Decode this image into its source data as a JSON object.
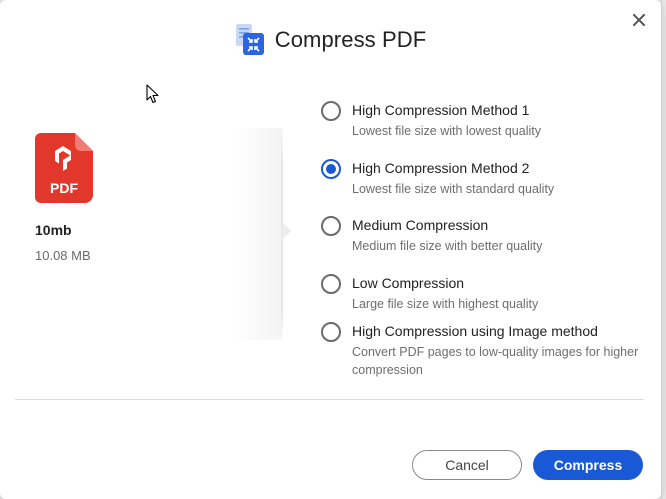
{
  "dialog": {
    "title": "Compress PDF",
    "close_icon": "close-icon"
  },
  "file": {
    "icon_text": "PDF",
    "name": "10mb",
    "size": "10.08 MB"
  },
  "options": [
    {
      "label": "High Compression Method 1",
      "desc": "Lowest file size with lowest quality",
      "checked": false
    },
    {
      "label": "High Compression Method 2",
      "desc": "Lowest file size with standard quality",
      "checked": true
    },
    {
      "label": "Medium Compression",
      "desc": "Medium file size with better quality",
      "checked": false
    },
    {
      "label": "Low Compression",
      "desc": "Large file size with highest quality",
      "checked": false
    },
    {
      "label": "High Compression using Image method",
      "desc": "Convert PDF pages to low-quality images for higher compression",
      "checked": false
    }
  ],
  "buttons": {
    "cancel": "Cancel",
    "compress": "Compress"
  },
  "colors": {
    "accent": "#1a59d6",
    "pdf_red": "#e2382b"
  }
}
